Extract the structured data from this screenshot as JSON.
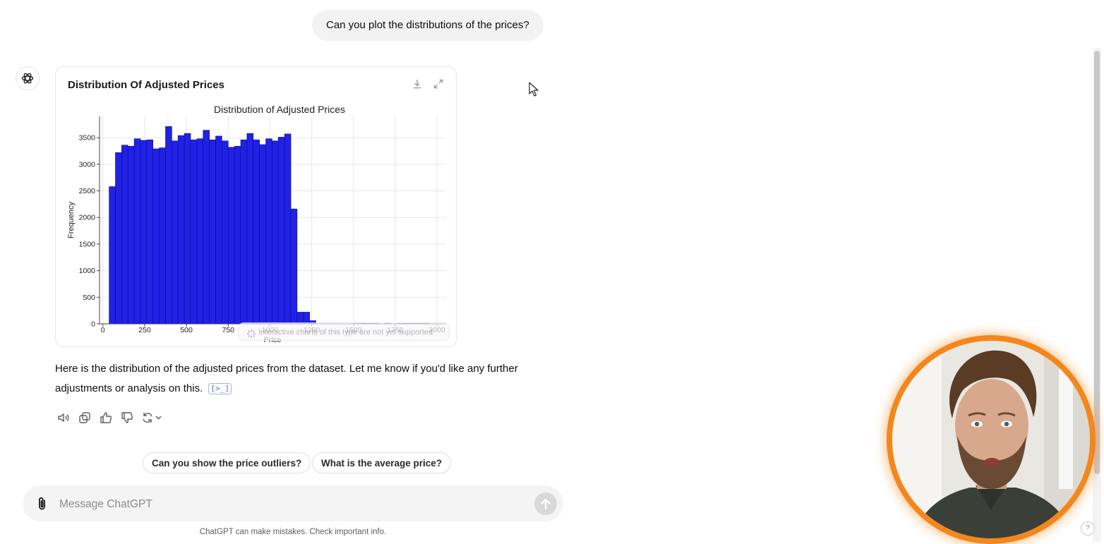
{
  "conversation": {
    "user_message": "Can you plot the distributions of the prices?",
    "chart_card": {
      "title": "Distribution Of Adjusted Prices",
      "download_icon": "download-icon",
      "expand_icon": "expand-icon",
      "notice": "Interactive charts of this type are not yet supported"
    },
    "response_text": "Here is the distribution of the adjusted prices from the dataset. Let me know if you'd like any further adjustments or analysis on this.",
    "code_ref_label": "[>_]",
    "actions": [
      "read-aloud-icon",
      "copy-icon",
      "thumbs-up-icon",
      "thumbs-down-icon",
      "regenerate-icon"
    ]
  },
  "chart_data": {
    "type": "bar",
    "title": "Distribution of Adjusted Prices",
    "xlabel": "Price",
    "ylabel": "Frequency",
    "xlim": [
      -20,
      2050
    ],
    "ylim": [
      0,
      3900
    ],
    "xticks": [
      0,
      250,
      500,
      750,
      1000,
      1250,
      1500,
      1750,
      2000
    ],
    "yticks": [
      0,
      500,
      1000,
      1500,
      2000,
      2500,
      3000,
      3500
    ],
    "grid": true,
    "bin_width": 37.5,
    "color": "#2121e6",
    "bins": [
      {
        "x": 37.5,
        "count": 2580
      },
      {
        "x": 75,
        "count": 3220
      },
      {
        "x": 112.5,
        "count": 3360
      },
      {
        "x": 150,
        "count": 3340
      },
      {
        "x": 187.5,
        "count": 3480
      },
      {
        "x": 225,
        "count": 3450
      },
      {
        "x": 262.5,
        "count": 3460
      },
      {
        "x": 300,
        "count": 3290
      },
      {
        "x": 337.5,
        "count": 3310
      },
      {
        "x": 375,
        "count": 3710
      },
      {
        "x": 412.5,
        "count": 3440
      },
      {
        "x": 450,
        "count": 3540
      },
      {
        "x": 487.5,
        "count": 3580
      },
      {
        "x": 525,
        "count": 3460
      },
      {
        "x": 562.5,
        "count": 3480
      },
      {
        "x": 600,
        "count": 3640
      },
      {
        "x": 637.5,
        "count": 3460
      },
      {
        "x": 675,
        "count": 3530
      },
      {
        "x": 712.5,
        "count": 3440
      },
      {
        "x": 750,
        "count": 3320
      },
      {
        "x": 787.5,
        "count": 3340
      },
      {
        "x": 825,
        "count": 3460
      },
      {
        "x": 862.5,
        "count": 3580
      },
      {
        "x": 900,
        "count": 3460
      },
      {
        "x": 937.5,
        "count": 3370
      },
      {
        "x": 975,
        "count": 3480
      },
      {
        "x": 1012.5,
        "count": 3440
      },
      {
        "x": 1050,
        "count": 3510
      },
      {
        "x": 1087.5,
        "count": 3570
      },
      {
        "x": 1125,
        "count": 2160
      },
      {
        "x": 1162.5,
        "count": 220
      },
      {
        "x": 1200,
        "count": 220
      },
      {
        "x": 1237.5,
        "count": 60
      },
      {
        "x": 1500,
        "count": 12
      },
      {
        "x": 1537.5,
        "count": 15
      },
      {
        "x": 1575,
        "count": 10
      },
      {
        "x": 1612.5,
        "count": 12
      },
      {
        "x": 1687.5,
        "count": 15
      },
      {
        "x": 1762.5,
        "count": 10
      },
      {
        "x": 1800,
        "count": 12
      },
      {
        "x": 1837.5,
        "count": 12
      },
      {
        "x": 1875,
        "count": 10
      },
      {
        "x": 1912.5,
        "count": 12
      }
    ]
  },
  "suggestions": [
    "Can you show the price outliers?",
    "What is the average price?"
  ],
  "composer": {
    "placeholder": "Message ChatGPT",
    "attach_icon": "paperclip-icon",
    "send_icon": "arrow-up-icon"
  },
  "footer": "ChatGPT can make mistakes. Check important info.",
  "help_label": "?"
}
